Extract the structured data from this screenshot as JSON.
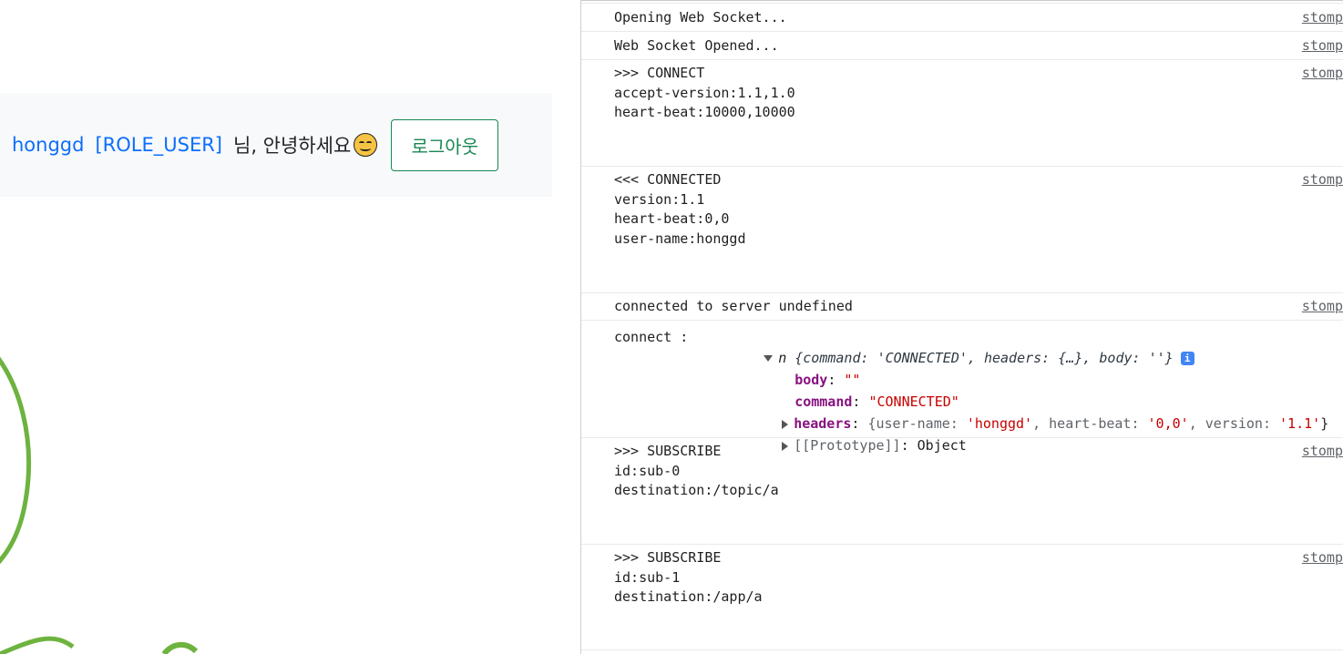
{
  "header": {
    "username": "honggd",
    "role": "[ROLE_USER]",
    "greeting": "님, 안녕하세요",
    "logout_label": "로그아웃"
  },
  "console": {
    "rows": [
      {
        "message": "Opening Web Socket...",
        "source": "stomp"
      },
      {
        "message": "Web Socket Opened...",
        "source": "stomp"
      },
      {
        "message": ">>> CONNECT\naccept-version:1.1,1.0\nheart-beat:10000,10000",
        "source": "stomp"
      },
      {
        "message": "<<< CONNECTED\nversion:1.1\nheart-beat:0,0\nuser-name:honggd",
        "source": "stomp"
      },
      {
        "message": "connected to server undefined",
        "source": "stomp"
      },
      {
        "message": ">>> SUBSCRIBE\nid:sub-0\ndestination:/topic/a",
        "source": "stomp"
      },
      {
        "message": ">>> SUBSCRIBE\nid:sub-1\ndestination:/app/a",
        "source": "stomp"
      }
    ],
    "object_log": {
      "label": "connect :",
      "object_name": "n",
      "summary_open": "{command: ",
      "summary_command": "'CONNECTED'",
      "summary_mid": ", headers: {…}, body: ",
      "summary_body": "''",
      "summary_close": "}",
      "info_icon_text": "i",
      "body_key": "body",
      "body_value": "\"\"",
      "command_key": "command",
      "command_value": "\"CONNECTED\"",
      "headers_key": "headers",
      "headers_open": "{user-name: ",
      "headers_user": "'honggd'",
      "headers_mid1": ", heart-beat: ",
      "headers_heartbeat": "'0,0'",
      "headers_mid2": ", version: ",
      "headers_version": "'1.1'",
      "headers_close": "}",
      "prototype_key": "[[Prototype]]",
      "prototype_value": "Object"
    }
  },
  "colors": {
    "link_blue": "#0d6efd",
    "success_green": "#198754",
    "devtools_key_purple": "#881280",
    "devtools_string_red": "#c80000",
    "leaf_green": "#6db33f"
  }
}
